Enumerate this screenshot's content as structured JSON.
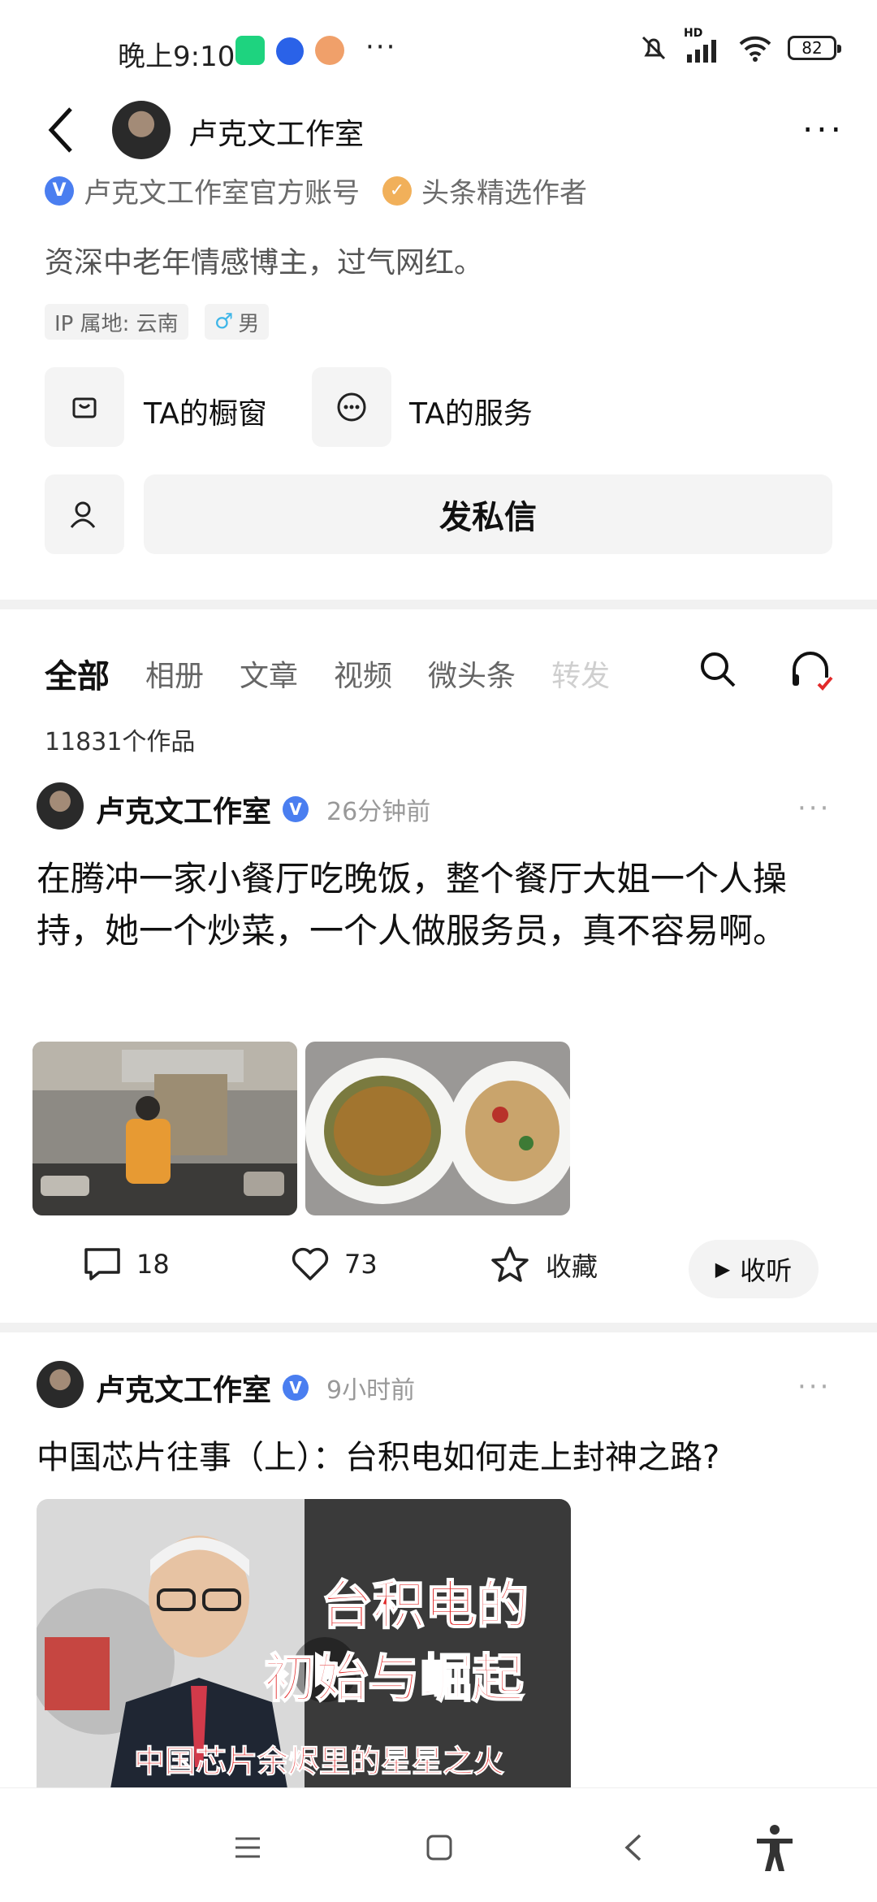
{
  "status_bar": {
    "time": "晚上9:10",
    "battery": "82",
    "network": "HD"
  },
  "header": {
    "title": "卢克文工作室"
  },
  "profile": {
    "verification": "卢克文工作室官方账号",
    "author_badge": "头条精选作者",
    "bio": "资深中老年情感博主，过气网红。",
    "ip_location": "IP 属地: 云南",
    "gender": "男",
    "actions": {
      "shop": "TA的橱窗",
      "service": "TA的服务",
      "message": "发私信"
    }
  },
  "tabs": [
    "全部",
    "相册",
    "文章",
    "视频",
    "微头条",
    "转发"
  ],
  "works_count": "11831个作品",
  "posts": [
    {
      "author": "卢克文工作室",
      "time": "26分钟前",
      "text": "在腾冲一家小餐厅吃晚饭，整个餐厅大姐一个人操持，她一个炒菜，一个人做服务员，真不容易啊。",
      "comments": "18",
      "likes": "73",
      "favorite": "收藏",
      "listen": "收听"
    },
    {
      "author": "卢克文工作室",
      "time": "9小时前",
      "text": "中国芯片往事（上）：台积电如何走上封神之路?",
      "thumb_title_line1": "台积电的",
      "thumb_title_line2": "初始与崛起",
      "thumb_subtitle": "中国芯片余烬里的星星之火"
    }
  ],
  "icons": {
    "back": "back-arrow-icon",
    "more": "more-icon",
    "search": "search-icon",
    "listen": "headphones-icon"
  },
  "colors": {
    "verify_blue": "#4a7ef0",
    "author_orange": "#f1b05a",
    "red_text": "#e22a2a"
  }
}
